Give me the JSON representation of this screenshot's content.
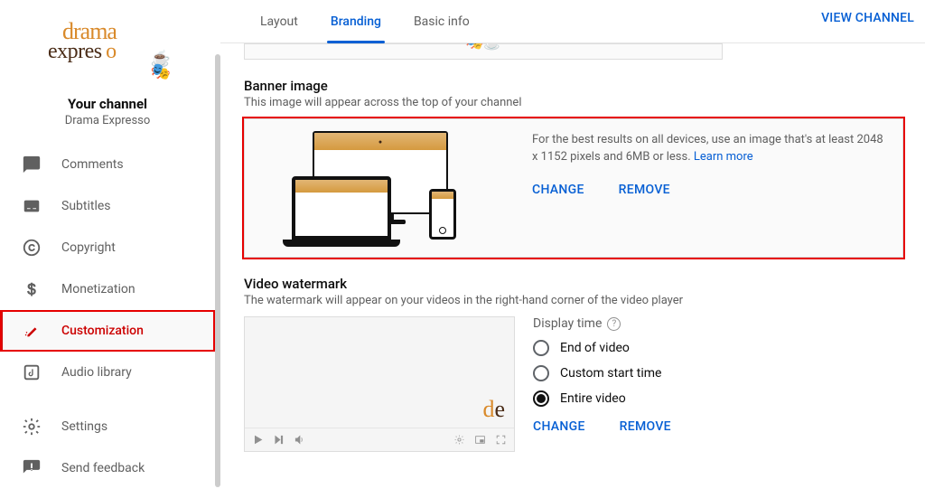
{
  "logo": {
    "line1": "drama",
    "line2_a": "expre",
    "line2_b": "s",
    "line2_c": "o"
  },
  "channel": {
    "your_channel_label": "Your channel",
    "name": "Drama Expresso"
  },
  "sidebar": {
    "items": [
      {
        "label": "Comments"
      },
      {
        "label": "Subtitles"
      },
      {
        "label": "Copyright"
      },
      {
        "label": "Monetization"
      },
      {
        "label": "Customization"
      },
      {
        "label": "Audio library"
      },
      {
        "label": "Settings"
      },
      {
        "label": "Send feedback"
      }
    ]
  },
  "tabs": {
    "layout": "Layout",
    "branding": "Branding",
    "basic_info": "Basic info"
  },
  "view_channel": "VIEW CHANNEL",
  "banner": {
    "title": "Banner image",
    "desc": "This image will appear across the top of your channel",
    "info": "For the best results on all devices, use an image that's at least 2048 x 1152 pixels and 6MB or less. ",
    "learn_more": "Learn more",
    "change": "CHANGE",
    "remove": "REMOVE"
  },
  "watermark": {
    "title": "Video watermark",
    "desc": "The watermark will appear on your videos in the right-hand corner of the video player",
    "display_time_label": "Display time",
    "options": {
      "end": "End of video",
      "custom": "Custom start time",
      "entire": "Entire video"
    },
    "change": "CHANGE",
    "remove": "REMOVE"
  }
}
